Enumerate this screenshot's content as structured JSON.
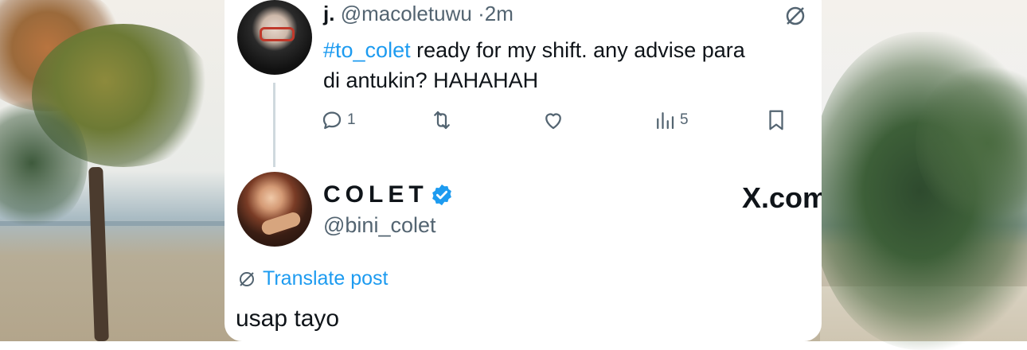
{
  "tweet1": {
    "display_name": "j.",
    "handle": "@macoletuwu",
    "separator": "·",
    "time": "2m",
    "hashtag": "#to_colet",
    "text_line1": " ready for my shift. any advise para",
    "text_line2": "di antukin? HAHAHAH",
    "reply_count": "1",
    "views_count": "5"
  },
  "tweet2": {
    "display_name": "COLET",
    "handle": "@bini_colet",
    "watermark": "X.com",
    "translate_label": "Translate post",
    "text": "usap tayo"
  },
  "colors": {
    "accent": "#1d9bf0",
    "secondary_text": "#536471",
    "primary_text": "#0f1419"
  },
  "icons": [
    "translate-icon",
    "reply-icon",
    "retweet-icon",
    "like-icon",
    "views-icon",
    "bookmark-icon",
    "verified-badge-icon"
  ]
}
